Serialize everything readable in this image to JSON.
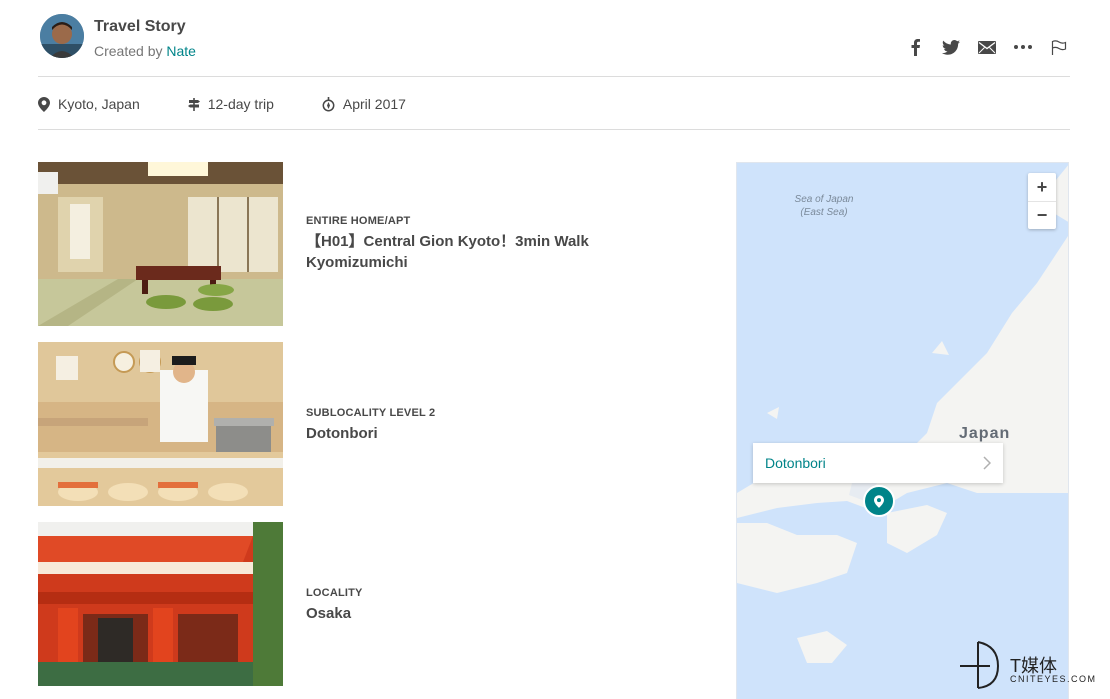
{
  "header": {
    "title": "Travel Story",
    "created_prefix": "Created by ",
    "author": "Nate"
  },
  "share": {
    "icons": [
      "facebook-icon",
      "twitter-icon",
      "email-icon",
      "more-icon",
      "flag-icon"
    ]
  },
  "meta": {
    "location": "Kyoto, Japan",
    "duration": "12-day trip",
    "date": "April 2017"
  },
  "listings": [
    {
      "category": "ENTIRE HOME/APT",
      "name": "【H01】Central Gion Kyoto！3min Walk Kyomizumichi"
    },
    {
      "category": "SUBLOCALITY LEVEL 2",
      "name": "Dotonbori"
    },
    {
      "category": "LOCALITY",
      "name": "Osaka"
    }
  ],
  "map": {
    "zoom_in": "+",
    "zoom_out": "−",
    "sea_label_1": "Sea of Japan",
    "sea_label_2": "(East Sea)",
    "country_label": "Japan",
    "popup_label": "Dotonbori",
    "water_color": "#cfe3fb",
    "accent": "#008489"
  },
  "watermark": {
    "zh": "T媒体",
    "en": "CNITEYES.COM"
  }
}
